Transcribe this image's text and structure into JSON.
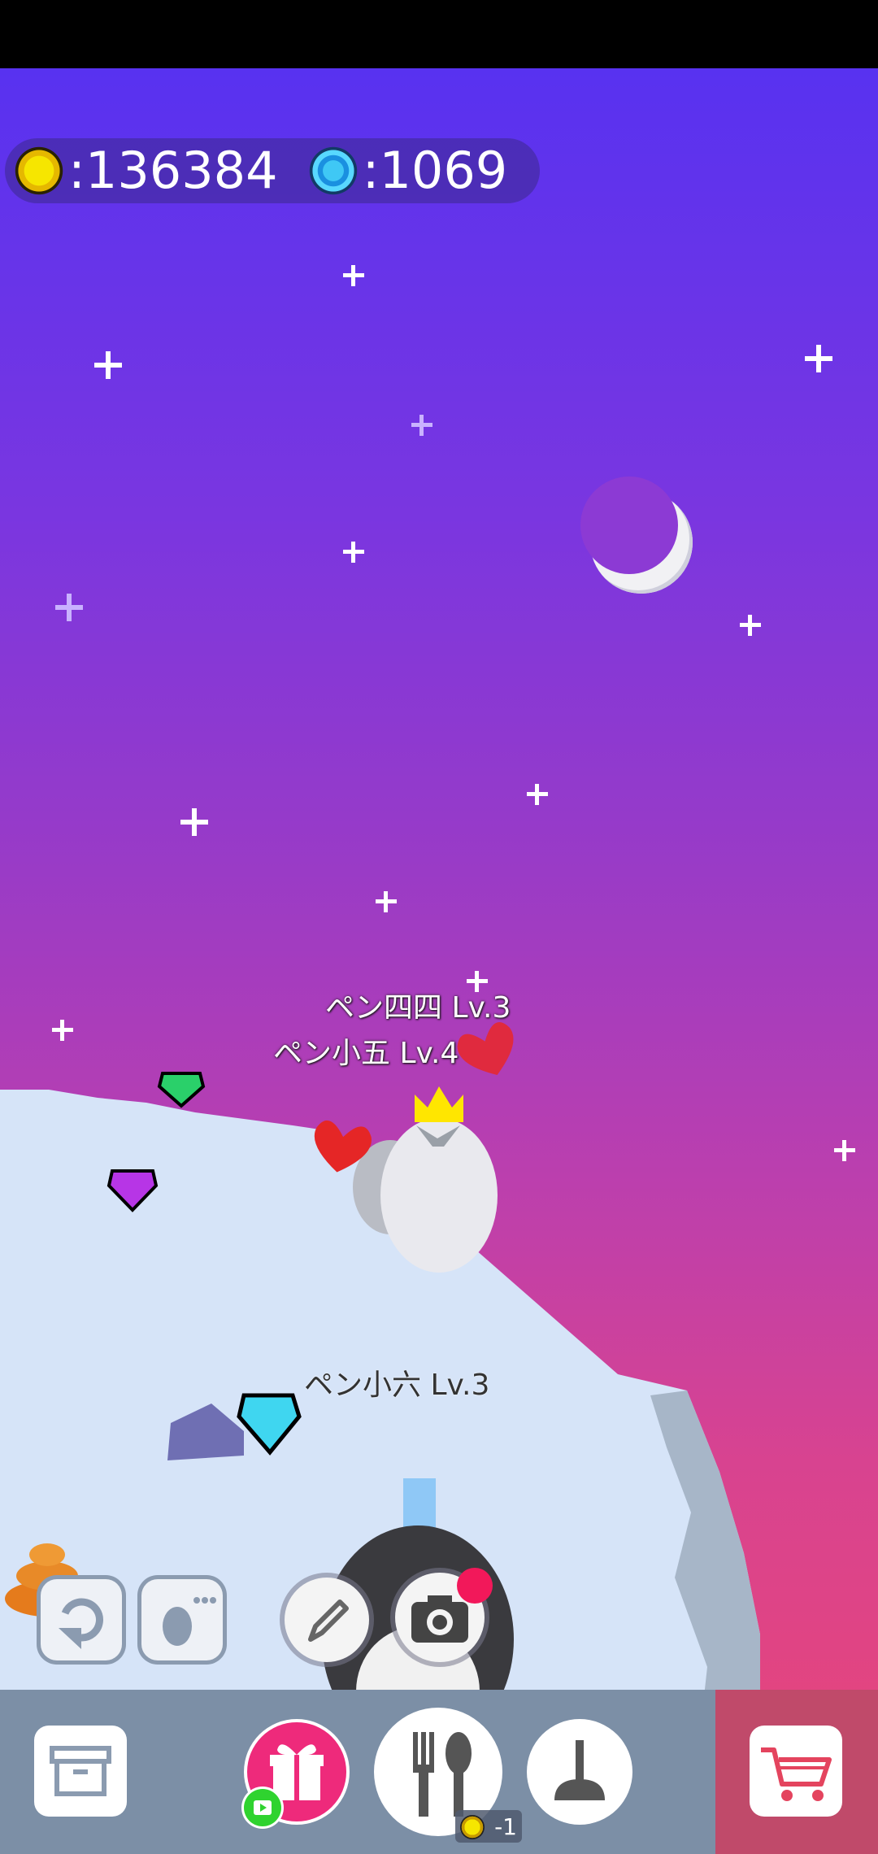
{
  "currency": {
    "coins": ":136384",
    "gems": ":1069"
  },
  "penguins": [
    {
      "name": "ペン四四",
      "level": "Lv.3"
    },
    {
      "name": "ペン小五",
      "level": "Lv.4"
    },
    {
      "name": "ペン小六",
      "level": "Lv.3"
    }
  ],
  "shop": {
    "feed_cost": "-1"
  },
  "colors": {
    "sky_top": "#5832f0",
    "sky_bottom": "#e94676",
    "ice": "#d6e4f8",
    "bar": "#7c8fa6",
    "notification": "#f2185a",
    "gift": "#ee2a7b"
  },
  "icons": [
    "coin-icon",
    "gem-icon",
    "rotate-icon",
    "penguin-list-icon",
    "pencil-icon",
    "camera-icon",
    "archive-box-icon",
    "gift-icon",
    "video-play-icon",
    "fork-spoon-icon",
    "plunger-icon",
    "cart-icon",
    "heart-icon",
    "crown-icon",
    "moon-icon",
    "star-icon"
  ]
}
